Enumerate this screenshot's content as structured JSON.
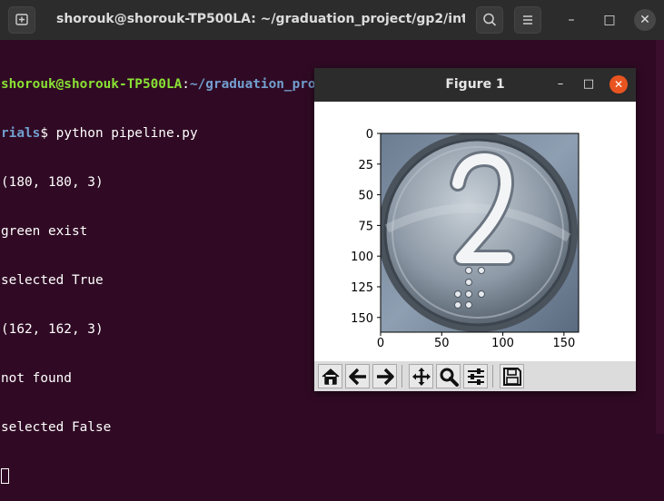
{
  "terminal_window": {
    "title": "shorouk@shorouk-TP500LA: ~/graduation_project/gp2/inter...",
    "controls": {
      "minimize": "–",
      "maximize": "□",
      "close": "✕"
    }
  },
  "terminal": {
    "prompt_user": "shorouk@shorouk-TP500LA",
    "prompt_sep": ":",
    "prompt_path_line1": "~/graduation_project/gp2/interaction_arm/vision/python_t",
    "prompt_path_line2": "rials",
    "prompt_symbol": "$ ",
    "command": "python pipeline.py",
    "output": [
      "(180, 180, 3)",
      "green exist",
      "selected True",
      "(162, 162, 3)",
      "not found",
      "selected False"
    ]
  },
  "figure_window": {
    "title": "Figure 1",
    "controls": {
      "minimize": "–",
      "maximize": "□",
      "close": "✕"
    },
    "toolbar": [
      "home-icon",
      "back-icon",
      "forward-icon",
      "pan-icon",
      "zoom-icon",
      "subplots-icon",
      "save-icon"
    ]
  },
  "chart_data": {
    "type": "image",
    "image_shape": [
      162,
      162,
      3
    ],
    "image_content": "elevator button with digit 2",
    "digit": "2",
    "xlim": [
      0,
      162
    ],
    "ylim": [
      162,
      0
    ],
    "xticks": [
      0,
      50,
      100,
      150
    ],
    "yticks": [
      0,
      25,
      50,
      75,
      100,
      125,
      150
    ],
    "grid": false
  },
  "colors": {
    "terminal_bg": "#300a24",
    "prompt_user": "#8ae234",
    "prompt_path": "#729fcf",
    "close_button": "#e95420"
  }
}
